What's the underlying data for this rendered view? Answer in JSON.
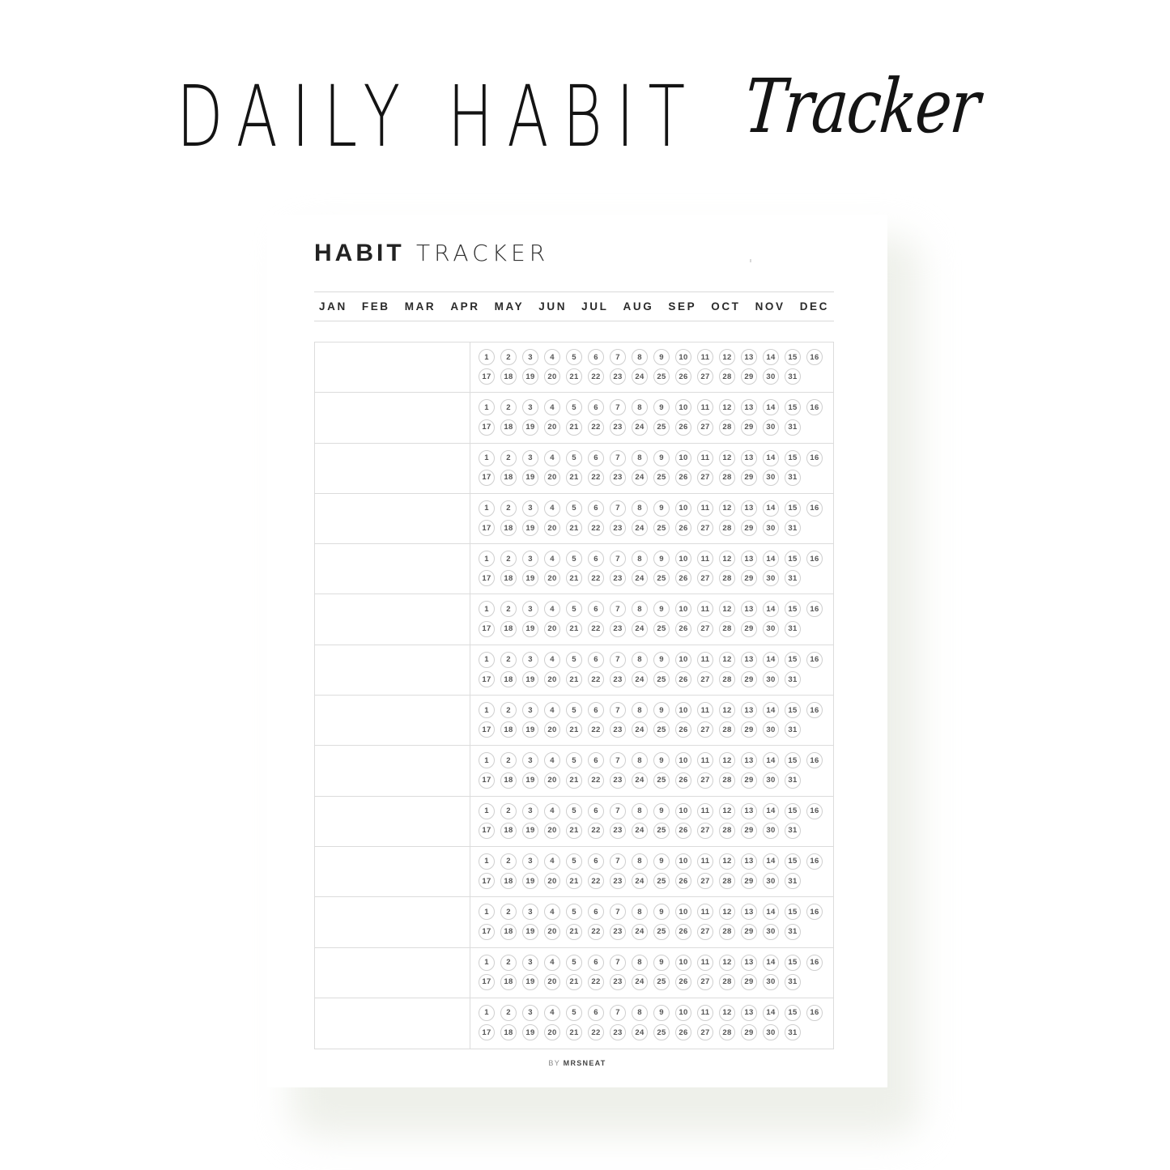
{
  "hero": {
    "title_main": "DAILY HABIT",
    "title_script": "Tracker"
  },
  "sheet": {
    "title_bold": "HABIT",
    "title_light": "TRACKER",
    "months": [
      "JAN",
      "FEB",
      "MAR",
      "APR",
      "MAY",
      "JUN",
      "JUL",
      "AUG",
      "SEP",
      "OCT",
      "NOV",
      "DEC"
    ],
    "habit_rows": 14,
    "habits": [
      "",
      "",
      "",
      "",
      "",
      "",
      "",
      "",
      "",
      "",
      "",
      "",
      "",
      ""
    ],
    "days_per_row": 31,
    "footer_prefix": "BY",
    "footer_brand": "MRSNEAT"
  },
  "colors": {
    "text": "#1a1a1a",
    "grid_line": "#dcdcdc",
    "circle_border": "#cfcfcf",
    "shadow": "#eef0ea"
  }
}
